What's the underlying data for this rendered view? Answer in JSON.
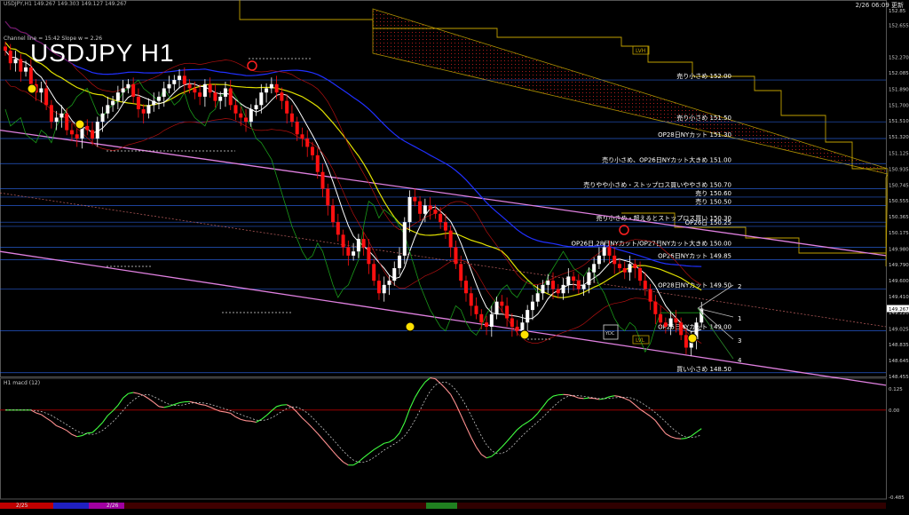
{
  "header": {
    "symbol_line": "USDJPY,H1 149.267 149.303 149.127 149.267",
    "channel_info": "Channel line = 15:42 Slope w = 2.26",
    "timestamp": "2/26 06:09 更新",
    "title": "USDJPY H1",
    "macd_label": "H1 macd (12)"
  },
  "chart_data": {
    "type": "candlestick",
    "symbol": "USDJPY",
    "timeframe": "H1",
    "price_axis": [
      152.655,
      152.27,
      152.085,
      151.89,
      151.7,
      151.51,
      151.32,
      151.125,
      150.935,
      150.745,
      150.555,
      150.365,
      150.175,
      149.98,
      149.79,
      149.6,
      149.41,
      149.22,
      149.025,
      148.835,
      148.645,
      148.455
    ],
    "price_axis_top": "152.85",
    "current_price": "149.267",
    "ylim": [
      148.455,
      152.85
    ],
    "levels": [
      {
        "label": "売り小さめ 152.00",
        "value": 152.0
      },
      {
        "label": "売り小さめ 151.50",
        "value": 151.5
      },
      {
        "label": "OP28日NYカット 151.30",
        "value": 151.3
      },
      {
        "label": "売り小さめ、OP26日NYカット大きめ 151.00",
        "value": 151.0
      },
      {
        "label": "売りやや小さめ・ストップロス買いややさめ 150.70",
        "value": 150.7
      },
      {
        "label": "売り 150.60",
        "value": 150.6
      },
      {
        "label": "売り 150.50",
        "value": 150.5
      },
      {
        "label": "売り小さめ・超えるとストップロス買い 150.30",
        "value": 150.3
      },
      {
        "label": "OP26日 150.25",
        "value": 150.25
      },
      {
        "label": "OP26日,28日NYカット/OP27日NYカット大きめ 150.00",
        "value": 150.0
      },
      {
        "label": "OP26日NYカット 149.85",
        "value": 149.85
      },
      {
        "label": "OP28日NYカット 149.50",
        "value": 149.5
      },
      {
        "label": "OP26日NYカット 149.00",
        "value": 149.0
      },
      {
        "label": "買い小さめ 148.50",
        "value": 148.5
      }
    ],
    "close_series": [
      152.35,
      152.2,
      152.25,
      152.1,
      152.15,
      151.95,
      151.85,
      151.9,
      151.7,
      151.5,
      151.55,
      151.6,
      151.4,
      151.35,
      151.3,
      151.45,
      151.4,
      151.3,
      151.5,
      151.6,
      151.7,
      151.75,
      151.85,
      151.9,
      151.95,
      151.8,
      151.65,
      151.6,
      151.7,
      151.75,
      151.8,
      151.9,
      151.95,
      152.0,
      152.05,
      151.95,
      151.9,
      151.85,
      151.8,
      151.95,
      151.85,
      151.75,
      151.8,
      151.9,
      151.7,
      151.6,
      151.55,
      151.5,
      151.65,
      151.7,
      151.85,
      151.9,
      151.95,
      151.85,
      151.75,
      151.6,
      151.5,
      151.35,
      151.3,
      151.2,
      151.1,
      150.9,
      150.7,
      150.5,
      150.3,
      150.15,
      150.0,
      149.9,
      149.95,
      150.1,
      150.0,
      149.8,
      149.6,
      149.45,
      149.55,
      149.6,
      149.75,
      149.9,
      150.3,
      150.6,
      150.55,
      150.4,
      150.5,
      150.45,
      150.4,
      150.3,
      150.2,
      150.0,
      149.8,
      149.6,
      149.45,
      149.3,
      149.2,
      149.1,
      149.05,
      149.2,
      149.35,
      149.3,
      149.15,
      149.05,
      149.0,
      149.1,
      149.25,
      149.35,
      149.45,
      149.55,
      149.6,
      149.5,
      149.45,
      149.55,
      149.65,
      149.6,
      149.5,
      149.55,
      149.7,
      149.8,
      149.9,
      150.0,
      149.9,
      149.8,
      149.75,
      149.7,
      149.8,
      149.75,
      149.6,
      149.5,
      149.35,
      149.2,
      149.1,
      149.05,
      149.15,
      149.1,
      148.95,
      148.8,
      148.9,
      149.1,
      149.267
    ],
    "marker_labels": [
      "YDC",
      "LVH",
      "LVL",
      "1",
      "2",
      "3",
      "4"
    ],
    "macd": {
      "axis": [
        "0.125",
        "0.00",
        "-0.485"
      ],
      "zero": 0.0,
      "ylim": [
        -0.485,
        0.125
      ]
    },
    "time_labels": [
      "2/25",
      "2/26"
    ],
    "colors": {
      "bull": "#ffffff",
      "bear": "#ff1010",
      "ma_short": "#ffffff",
      "ma_mid": "#e0e000",
      "ma_long": "#2030ff",
      "channel": "#e080e0",
      "cloud": "#c0a000",
      "level": "#3070ff",
      "macd_up": "#40ff40",
      "macd_down": "#ff9090"
    }
  }
}
